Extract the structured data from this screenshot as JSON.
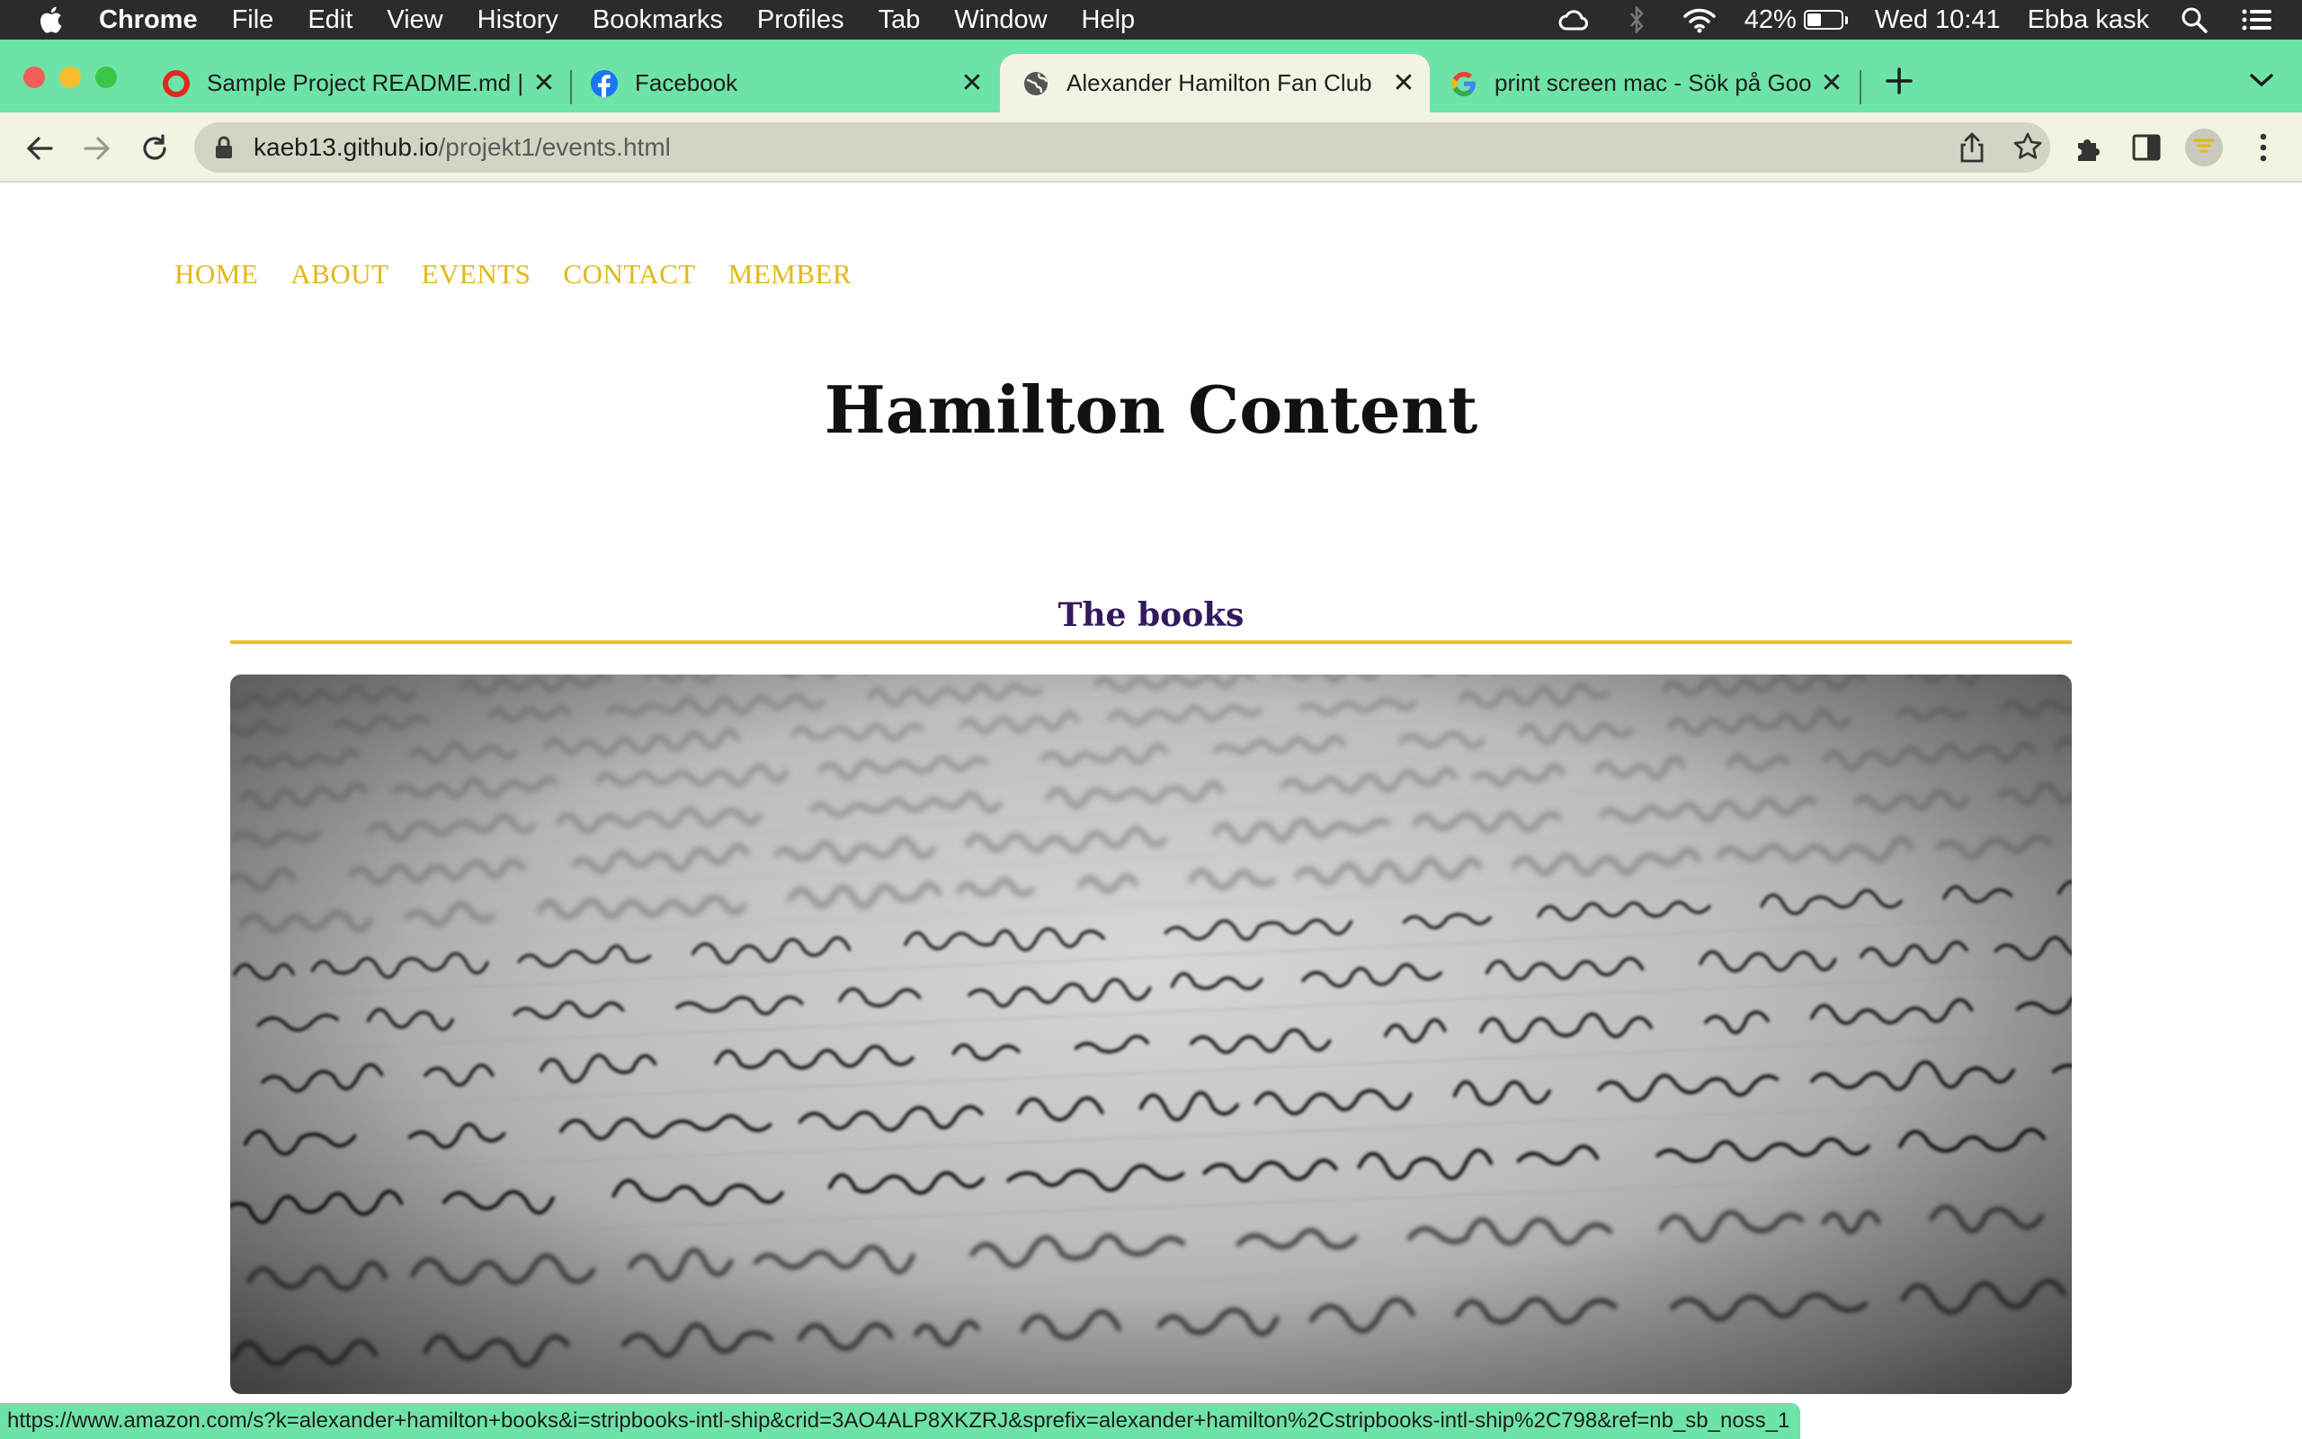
{
  "menubar": {
    "app_name": "Chrome",
    "items": [
      "File",
      "Edit",
      "View",
      "History",
      "Bookmarks",
      "Profiles",
      "Tab",
      "Window",
      "Help"
    ],
    "battery_percent": "42%",
    "battery_level": 0.42,
    "clock": "Wed 10:41",
    "user": "Ebba kask"
  },
  "browser": {
    "accent_color": "#6ee3a7",
    "tabs": [
      {
        "title": "Sample Project README.md | P",
        "favicon": "opera-icon",
        "active": false
      },
      {
        "title": "Facebook",
        "favicon": "facebook-icon",
        "active": false
      },
      {
        "title": "Alexander Hamilton Fan Club",
        "favicon": "globe-icon",
        "active": true
      },
      {
        "title": "print screen mac - Sök på Goo",
        "favicon": "google-icon",
        "active": false
      }
    ],
    "url_host": "kaeb13.github.io",
    "url_path": "/projekt1/events.html"
  },
  "site": {
    "nav": [
      "HOME",
      "ABOUT",
      "EVENTS",
      "CONTACT",
      "MEMBER"
    ],
    "nav_color": "#e2b817",
    "title": "Hamilton Content",
    "section_heading": "The books",
    "section_heading_color": "#33195e",
    "rule_color": "#e9c12c",
    "hero_image": "handwritten-letter-photo"
  },
  "status_bar": {
    "link_url": "https://www.amazon.com/s?k=alexander+hamilton+books&i=stripbooks-intl-ship&crid=3AO4ALP8XKZRJ&sprefix=alexander+hamilton%2Cstripbooks-intl-ship%2C798&ref=nb_sb_noss_1"
  }
}
